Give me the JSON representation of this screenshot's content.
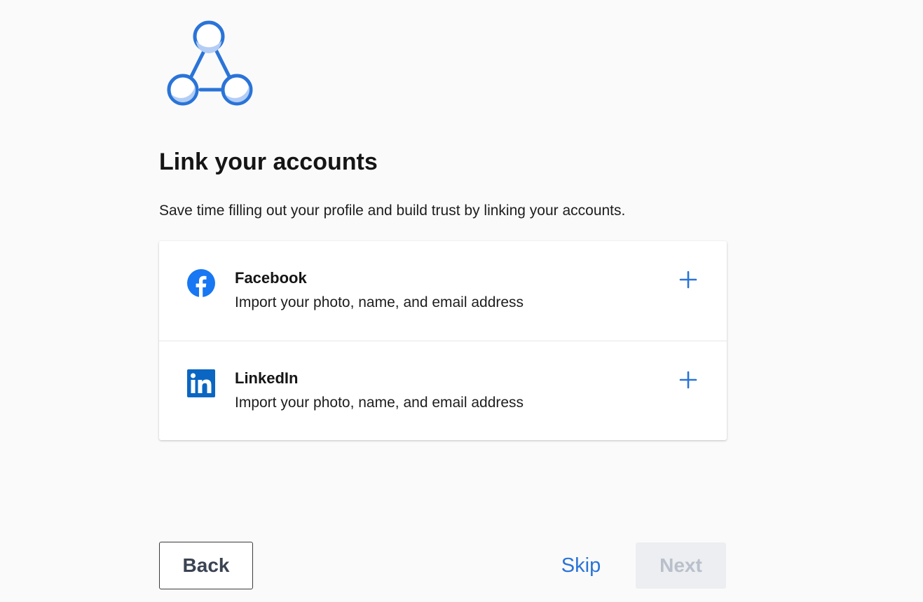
{
  "page": {
    "title": "Link your accounts",
    "subtitle": "Save time filling out your profile and build trust by linking your accounts."
  },
  "accounts": [
    {
      "name": "Facebook",
      "description": "Import your photo, name, and email address",
      "icon": "facebook-icon",
      "action_icon": "plus-icon"
    },
    {
      "name": "LinkedIn",
      "description": "Import your photo, name, and email address",
      "icon": "linkedin-icon",
      "action_icon": "plus-icon"
    }
  ],
  "footer": {
    "back_label": "Back",
    "skip_label": "Skip",
    "next_label": "Next",
    "next_enabled": false
  },
  "colors": {
    "accent": "#2a74d8",
    "facebook": "#1877f2",
    "linkedin": "#0a66c2",
    "icon_fill": "#b3cdf5",
    "next_disabled_bg": "#eceef1",
    "next_disabled_text": "#b9c0cb"
  }
}
